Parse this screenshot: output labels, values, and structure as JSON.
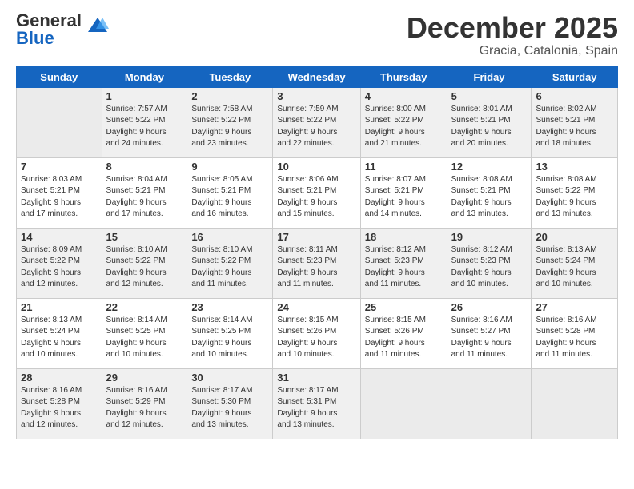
{
  "logo": {
    "general": "General",
    "blue": "Blue"
  },
  "title": "December 2025",
  "location": "Gracia, Catalonia, Spain",
  "weekdays": [
    "Sunday",
    "Monday",
    "Tuesday",
    "Wednesday",
    "Thursday",
    "Friday",
    "Saturday"
  ],
  "weeks": [
    [
      {
        "day": "",
        "info": ""
      },
      {
        "day": "1",
        "info": "Sunrise: 7:57 AM\nSunset: 5:22 PM\nDaylight: 9 hours\nand 24 minutes."
      },
      {
        "day": "2",
        "info": "Sunrise: 7:58 AM\nSunset: 5:22 PM\nDaylight: 9 hours\nand 23 minutes."
      },
      {
        "day": "3",
        "info": "Sunrise: 7:59 AM\nSunset: 5:22 PM\nDaylight: 9 hours\nand 22 minutes."
      },
      {
        "day": "4",
        "info": "Sunrise: 8:00 AM\nSunset: 5:22 PM\nDaylight: 9 hours\nand 21 minutes."
      },
      {
        "day": "5",
        "info": "Sunrise: 8:01 AM\nSunset: 5:21 PM\nDaylight: 9 hours\nand 20 minutes."
      },
      {
        "day": "6",
        "info": "Sunrise: 8:02 AM\nSunset: 5:21 PM\nDaylight: 9 hours\nand 18 minutes."
      }
    ],
    [
      {
        "day": "7",
        "info": "Sunrise: 8:03 AM\nSunset: 5:21 PM\nDaylight: 9 hours\nand 17 minutes."
      },
      {
        "day": "8",
        "info": "Sunrise: 8:04 AM\nSunset: 5:21 PM\nDaylight: 9 hours\nand 17 minutes."
      },
      {
        "day": "9",
        "info": "Sunrise: 8:05 AM\nSunset: 5:21 PM\nDaylight: 9 hours\nand 16 minutes."
      },
      {
        "day": "10",
        "info": "Sunrise: 8:06 AM\nSunset: 5:21 PM\nDaylight: 9 hours\nand 15 minutes."
      },
      {
        "day": "11",
        "info": "Sunrise: 8:07 AM\nSunset: 5:21 PM\nDaylight: 9 hours\nand 14 minutes."
      },
      {
        "day": "12",
        "info": "Sunrise: 8:08 AM\nSunset: 5:21 PM\nDaylight: 9 hours\nand 13 minutes."
      },
      {
        "day": "13",
        "info": "Sunrise: 8:08 AM\nSunset: 5:22 PM\nDaylight: 9 hours\nand 13 minutes."
      }
    ],
    [
      {
        "day": "14",
        "info": "Sunrise: 8:09 AM\nSunset: 5:22 PM\nDaylight: 9 hours\nand 12 minutes."
      },
      {
        "day": "15",
        "info": "Sunrise: 8:10 AM\nSunset: 5:22 PM\nDaylight: 9 hours\nand 12 minutes."
      },
      {
        "day": "16",
        "info": "Sunrise: 8:10 AM\nSunset: 5:22 PM\nDaylight: 9 hours\nand 11 minutes."
      },
      {
        "day": "17",
        "info": "Sunrise: 8:11 AM\nSunset: 5:23 PM\nDaylight: 9 hours\nand 11 minutes."
      },
      {
        "day": "18",
        "info": "Sunrise: 8:12 AM\nSunset: 5:23 PM\nDaylight: 9 hours\nand 11 minutes."
      },
      {
        "day": "19",
        "info": "Sunrise: 8:12 AM\nSunset: 5:23 PM\nDaylight: 9 hours\nand 10 minutes."
      },
      {
        "day": "20",
        "info": "Sunrise: 8:13 AM\nSunset: 5:24 PM\nDaylight: 9 hours\nand 10 minutes."
      }
    ],
    [
      {
        "day": "21",
        "info": "Sunrise: 8:13 AM\nSunset: 5:24 PM\nDaylight: 9 hours\nand 10 minutes."
      },
      {
        "day": "22",
        "info": "Sunrise: 8:14 AM\nSunset: 5:25 PM\nDaylight: 9 hours\nand 10 minutes."
      },
      {
        "day": "23",
        "info": "Sunrise: 8:14 AM\nSunset: 5:25 PM\nDaylight: 9 hours\nand 10 minutes."
      },
      {
        "day": "24",
        "info": "Sunrise: 8:15 AM\nSunset: 5:26 PM\nDaylight: 9 hours\nand 10 minutes."
      },
      {
        "day": "25",
        "info": "Sunrise: 8:15 AM\nSunset: 5:26 PM\nDaylight: 9 hours\nand 11 minutes."
      },
      {
        "day": "26",
        "info": "Sunrise: 8:16 AM\nSunset: 5:27 PM\nDaylight: 9 hours\nand 11 minutes."
      },
      {
        "day": "27",
        "info": "Sunrise: 8:16 AM\nSunset: 5:28 PM\nDaylight: 9 hours\nand 11 minutes."
      }
    ],
    [
      {
        "day": "28",
        "info": "Sunrise: 8:16 AM\nSunset: 5:28 PM\nDaylight: 9 hours\nand 12 minutes."
      },
      {
        "day": "29",
        "info": "Sunrise: 8:16 AM\nSunset: 5:29 PM\nDaylight: 9 hours\nand 12 minutes."
      },
      {
        "day": "30",
        "info": "Sunrise: 8:17 AM\nSunset: 5:30 PM\nDaylight: 9 hours\nand 13 minutes."
      },
      {
        "day": "31",
        "info": "Sunrise: 8:17 AM\nSunset: 5:31 PM\nDaylight: 9 hours\nand 13 minutes."
      },
      {
        "day": "",
        "info": ""
      },
      {
        "day": "",
        "info": ""
      },
      {
        "day": "",
        "info": ""
      }
    ]
  ]
}
